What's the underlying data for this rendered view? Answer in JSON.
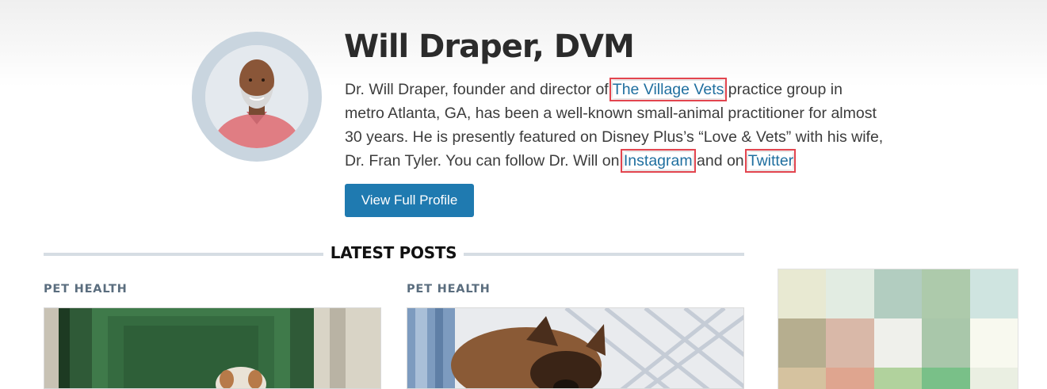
{
  "author": {
    "name": "Will Draper, DVM",
    "bio_segments": [
      {
        "text": "Dr. Will Draper, founder and director of ",
        "link": false
      },
      {
        "text": "The Village Vets",
        "link": true
      },
      {
        "text": " practice group in metro Atlanta, GA, has been a well-known small-animal practitioner for almost 30 years. He is presently featured on Disney Plus’s “Love & Vets” with his wife, Dr. Fran Tyler. You can follow Dr. Will on ",
        "link": false
      },
      {
        "text": "Instagram",
        "link": true
      },
      {
        "text": " and on ",
        "link": false
      },
      {
        "text": "Twitter",
        "link": true
      },
      {
        "text": ".",
        "link": false
      }
    ],
    "profile_button_label": "View Full Profile"
  },
  "latest_posts": {
    "title": "LATEST POSTS",
    "posts": [
      {
        "category": "PET HEALTH"
      },
      {
        "category": "PET HEALTH"
      }
    ]
  },
  "ad_mosaic_colors": [
    "#e8e9d2",
    "#e2ece2",
    "#b2cdc0",
    "#adcaab",
    "#cfe4e0",
    "#b6ae8f",
    "#d9b8a8",
    "#eff0eb",
    "#a9c7aa",
    "#f8f9ef",
    "#d5c29f",
    "#dfa58f",
    "#b1d29d",
    "#79c088",
    "#eaefe2"
  ],
  "colors": {
    "accent": "#1f7ab0",
    "link": "#1f6f9f",
    "highlight": "#e3454f"
  }
}
